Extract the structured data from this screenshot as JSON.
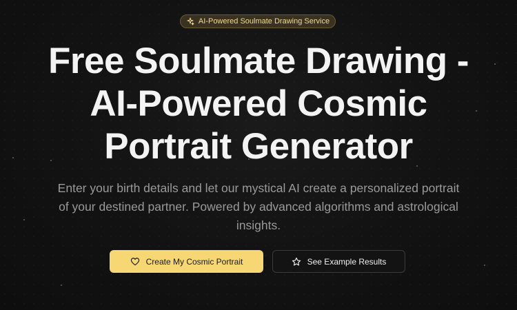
{
  "badge": {
    "icon": "sparkles-icon",
    "label": "AI-Powered Soulmate Drawing Service"
  },
  "hero": {
    "title_lines": [
      "Free Soulmate Drawing -",
      "AI-Powered Cosmic",
      "Portrait Generator"
    ],
    "description_lines": [
      "Enter your birth details and let our mystical AI create a personalized portrait",
      "of your destined partner. Powered by advanced algorithms and astrological",
      "insights."
    ]
  },
  "actions": {
    "primary": {
      "icon": "heart-icon",
      "label": "Create My Cosmic Portrait"
    },
    "secondary": {
      "icon": "star-icon",
      "label": "See Example Results"
    }
  },
  "colors": {
    "background": "#111111",
    "accent": "#f7d774",
    "badge_background": "#3a3120",
    "badge_text": "#f1dc9a",
    "muted_text": "#9a9a9a"
  }
}
